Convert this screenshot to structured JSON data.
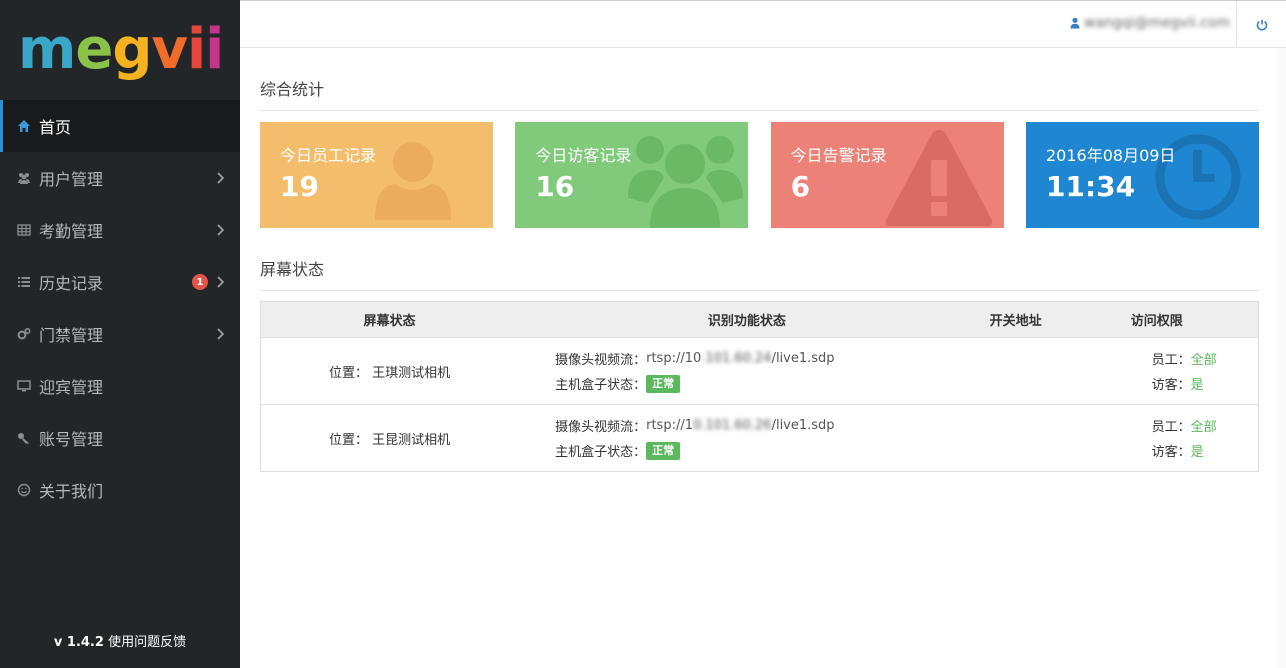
{
  "sidebar": {
    "logo": [
      "m",
      "e",
      "g",
      "v",
      "i",
      "i"
    ],
    "items": [
      {
        "label": "首页",
        "icon": "home-icon"
      },
      {
        "label": "用户管理",
        "icon": "users-icon"
      },
      {
        "label": "考勤管理",
        "icon": "table-icon"
      },
      {
        "label": "历史记录",
        "icon": "list-icon",
        "badge": "1"
      },
      {
        "label": "门禁管理",
        "icon": "gears-icon"
      },
      {
        "label": "迎宾管理",
        "icon": "monitor-icon"
      },
      {
        "label": "账号管理",
        "icon": "key-icon"
      },
      {
        "label": "关于我们",
        "icon": "smile-icon"
      }
    ],
    "version": "v 1.4.2",
    "feedback": "使用问题反馈"
  },
  "topbar": {
    "email": "wangqi@megvii.com"
  },
  "overview": {
    "title": "综合统计",
    "cards": [
      {
        "label": "今日员工记录",
        "value": "19",
        "color": "#f4bd6c"
      },
      {
        "label": "今日访客记录",
        "value": "16",
        "color": "#81c97b"
      },
      {
        "label": "今日告警记录",
        "value": "6",
        "color": "#ec8178"
      },
      {
        "label": "2016年08月09日",
        "value": "11:34",
        "color": "#1f87d1"
      }
    ]
  },
  "screen": {
    "title": "屏幕状态",
    "headers": [
      "屏幕状态",
      "识别功能状态",
      "开关地址",
      "访问权限"
    ],
    "rows": [
      {
        "location_label": "位置：",
        "location": "王琪测试相机",
        "stream_label": "摄像头视频流：",
        "stream_prefix": "rtsp://10",
        "stream_hidden": ".101.60.24",
        "stream_suffix": "/live1.sdp",
        "box_label": "主机盒子状态：",
        "box_status": "正常",
        "employee_label": "员工：",
        "employee_value": "全部",
        "visitor_label": "访客：",
        "visitor_value": "是"
      },
      {
        "location_label": "位置：",
        "location": "王昆测试相机",
        "stream_label": "摄像头视频流：",
        "stream_prefix": "rtsp://1",
        "stream_hidden": "0.101.60.26",
        "stream_suffix": "/live1.sdp",
        "box_label": "主机盒子状态：",
        "box_status": "正常",
        "employee_label": "员工：",
        "employee_value": "全部",
        "visitor_label": "访客：",
        "visitor_value": "是"
      }
    ]
  }
}
